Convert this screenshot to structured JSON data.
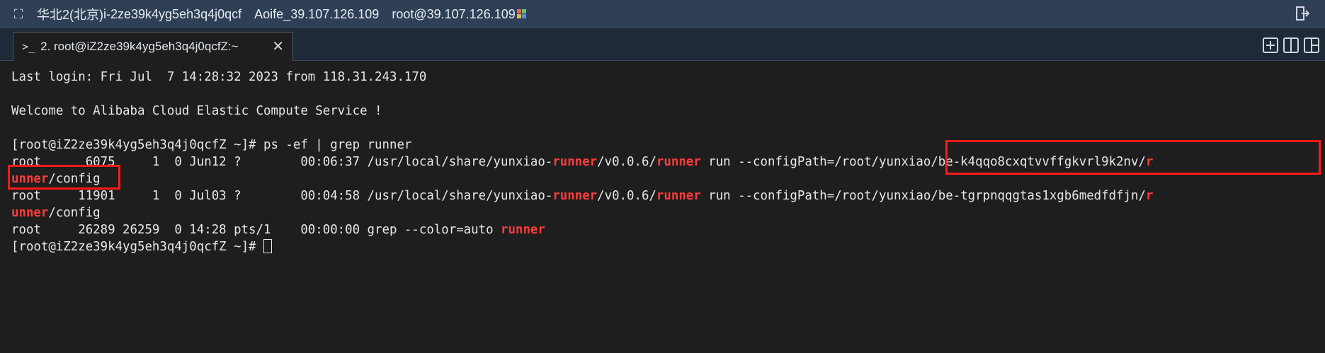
{
  "titlebar": {
    "region": "华北2(北京)",
    "instance": "i-2ze39k4yg5eh3q4j0qcf",
    "name": "Aoife_39.107.126.109",
    "user_host": "root@39.107.126.109"
  },
  "tab": {
    "icon_text": ">_",
    "label": "2. root@iZ2ze39k4yg5eh3q4j0qcfZ:~",
    "close": "✕"
  },
  "terminal": {
    "last_login": "Last login: Fri Jul  7 14:28:32 2023 from 118.31.243.170",
    "welcome": "Welcome to Alibaba Cloud Elastic Compute Service !",
    "prompt": "[root@iZ2ze39k4yg5eh3q4j0qcfZ ~]# ",
    "command": "ps -ef | grep runner",
    "p1": {
      "head": "root      6075     1  0 Jun12 ?        00:06:37 /usr/local/share/yunxiao-",
      "hl1": "runner",
      "mid": "/v0.0.6/",
      "hl2": "runner",
      "tail": " run --configPath=/root/yunxiao/be-k4qqo8cxqtvvffgkvrl9k2nv/",
      "hl3": "r",
      "wrap_hl": "unner",
      "wrap_tail": "/config"
    },
    "p2": {
      "head": "root     11901     1  0 Jul03 ?        00:04:58 /usr/local/share/yunxiao-",
      "hl1": "runner",
      "mid": "/v0.0.6/",
      "hl2": "runner",
      "tail": " run --configPath=/root/yunxiao/be-tgrpnqqgtas1xgb6medfdfjn/",
      "hl3": "r",
      "wrap_hl": "unner",
      "wrap_tail": "/config"
    },
    "p3": {
      "head": "root     26289 26259  0 14:28 pts/1    00:00:00 grep --color=auto ",
      "hl": "runner"
    },
    "final_prompt": "[root@iZ2ze39k4yg5eh3q4j0qcfZ ~]# "
  },
  "colors": {
    "titlebar_bg": "#2f3f55",
    "terminal_bg": "#1e1e1e",
    "match_red": "#ff3b3b",
    "annotation_red": "#ff1a1a"
  }
}
